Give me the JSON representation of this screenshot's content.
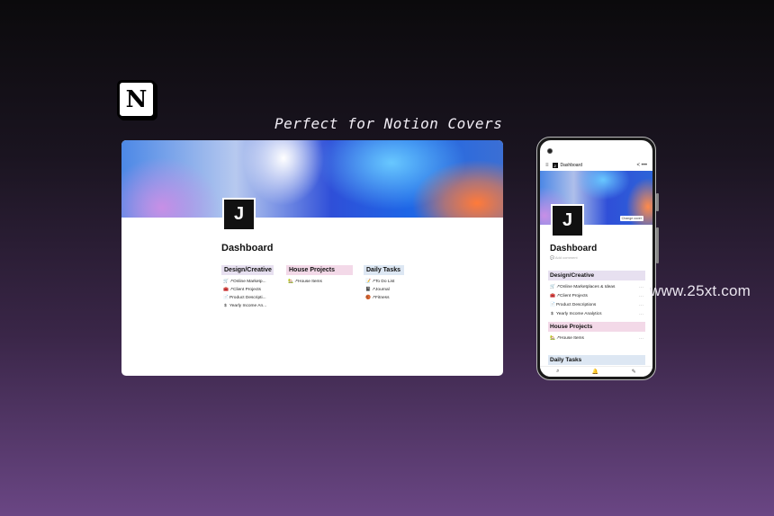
{
  "logo_letter": "N",
  "tagline": "Perfect for Notion Covers",
  "watermark": "www.25xt.com",
  "desktop": {
    "avatar_letter": "J",
    "title": "Dashboard",
    "columns": [
      {
        "header": "Design/Creative",
        "items": [
          {
            "icon": "🛒",
            "label": "↗Online Marketp..."
          },
          {
            "icon": "🧰",
            "label": "↗Client Projects"
          },
          {
            "icon": "📄",
            "label": "Product Descripti..."
          },
          {
            "icon": "$",
            "label": "Yearly Income An..."
          }
        ]
      },
      {
        "header": "House Projects",
        "items": [
          {
            "icon": "🏡",
            "label": "↗House Items"
          }
        ]
      },
      {
        "header": "Daily Tasks",
        "items": [
          {
            "icon": "📝",
            "label": "↗To Do List"
          },
          {
            "icon": "📓",
            "label": "↗Journal"
          },
          {
            "icon": "🏀",
            "label": "↗Fitness"
          }
        ]
      }
    ]
  },
  "phone": {
    "topbar_title": "Dashboard",
    "topbar_avatar": "J",
    "topbar_actions": "< •••",
    "change_cover": "Change cover",
    "avatar_letter": "J",
    "title": "Dashboard",
    "add_comment": "💬 Add comment",
    "sections": [
      {
        "header": "Design/Creative",
        "items": [
          {
            "icon": "🛒",
            "label": "↗Online Marketplaces & Ideas"
          },
          {
            "icon": "🧰",
            "label": "↗Client Projects"
          },
          {
            "icon": "📄",
            "label": "Product Descriptions"
          },
          {
            "icon": "$",
            "label": "Yearly Income Analytics"
          }
        ]
      },
      {
        "header": "House Projects",
        "items": [
          {
            "icon": "🏡",
            "label": "↗House Items"
          }
        ]
      },
      {
        "header": "Daily Tasks",
        "items": []
      }
    ],
    "bottom_icons": [
      "search-icon",
      "bell-icon",
      "compose-icon"
    ],
    "bottom_glyphs": [
      "⌕",
      "🔔",
      "✎"
    ]
  }
}
